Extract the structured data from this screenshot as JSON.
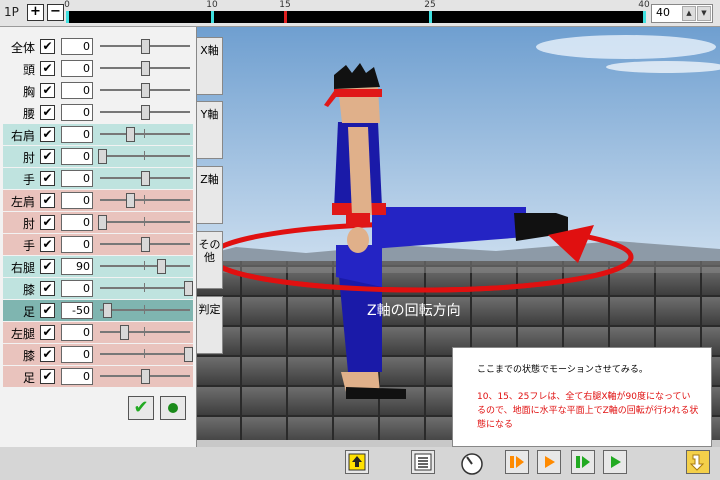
{
  "header": {
    "player": "1P",
    "plus": "+",
    "minus": "−",
    "frame_value": "40",
    "spin_up": "▲",
    "spin_down": "▼"
  },
  "timeline": {
    "max_frame": 40,
    "marks": [
      {
        "frame": 0,
        "label": "0",
        "color": "#40e0e0"
      },
      {
        "frame": 10,
        "label": "10",
        "color": "#40e0e0"
      },
      {
        "frame": 15,
        "label": "15",
        "color": "#e02020"
      },
      {
        "frame": 25,
        "label": "25",
        "color": "#40e0e0"
      },
      {
        "frame": 40,
        "label": "40",
        "color": "#40e0e0"
      }
    ]
  },
  "joints": [
    {
      "label": "全体",
      "value": "0",
      "level": 0.5,
      "group": "none"
    },
    {
      "label": "頭",
      "value": "0",
      "level": 0.5,
      "group": "none"
    },
    {
      "label": "胸",
      "value": "0",
      "level": 0.5,
      "group": "none"
    },
    {
      "label": "腰",
      "value": "0",
      "level": 0.5,
      "group": "none"
    },
    {
      "label": "右肩",
      "value": "0",
      "level": 0.33,
      "group": "teal"
    },
    {
      "label": "肘",
      "value": "0",
      "level": 0.02,
      "group": "teal"
    },
    {
      "label": "手",
      "value": "0",
      "level": 0.5,
      "group": "teal"
    },
    {
      "label": "左肩",
      "value": "0",
      "level": 0.33,
      "group": "pink"
    },
    {
      "label": "肘",
      "value": "0",
      "level": 0.02,
      "group": "pink"
    },
    {
      "label": "手",
      "value": "0",
      "level": 0.5,
      "group": "pink"
    },
    {
      "label": "右腿",
      "value": "90",
      "level": 0.68,
      "group": "teal"
    },
    {
      "label": "膝",
      "value": "0",
      "level": 0.98,
      "group": "teal"
    },
    {
      "label": "足",
      "value": "-50",
      "level": 0.08,
      "group": "tealdark"
    },
    {
      "label": "左腿",
      "value": "0",
      "level": 0.27,
      "group": "pink"
    },
    {
      "label": "膝",
      "value": "0",
      "level": 0.98,
      "group": "pink"
    },
    {
      "label": "足",
      "value": "0",
      "level": 0.5,
      "group": "pink"
    }
  ],
  "joint_check": "✔",
  "panel": {
    "ok": "✔"
  },
  "axis_tabs": [
    {
      "label": "X軸",
      "name": "tab-x-axis"
    },
    {
      "label": "Y軸",
      "name": "tab-y-axis"
    },
    {
      "label": "Z軸",
      "name": "tab-z-axis"
    },
    {
      "label": "その他",
      "name": "tab-other"
    },
    {
      "label": "判定",
      "name": "tab-hit"
    }
  ],
  "viewport": {
    "caption": "Z軸の回転方向"
  },
  "info": {
    "line1": "ここまでの状態でモーションさせてみる。",
    "line2": "10、15、25フレは、全て右腿X軸が90度になっているので、地面に水平な平面上でZ軸の回転が行われる状態になる"
  },
  "colors": {
    "group_teal": "#bfe3df",
    "group_tealdark": "#7fb5b0",
    "group_pink": "#e9c3bd",
    "accent_red": "#e01010",
    "sky": "#8fb7dc"
  },
  "icons": [
    "upload-icon",
    "list-icon",
    "dial-icon",
    "play-from-start-icon",
    "play-icon",
    "step-icon",
    "play-green-icon",
    "return-arrow-icon"
  ]
}
